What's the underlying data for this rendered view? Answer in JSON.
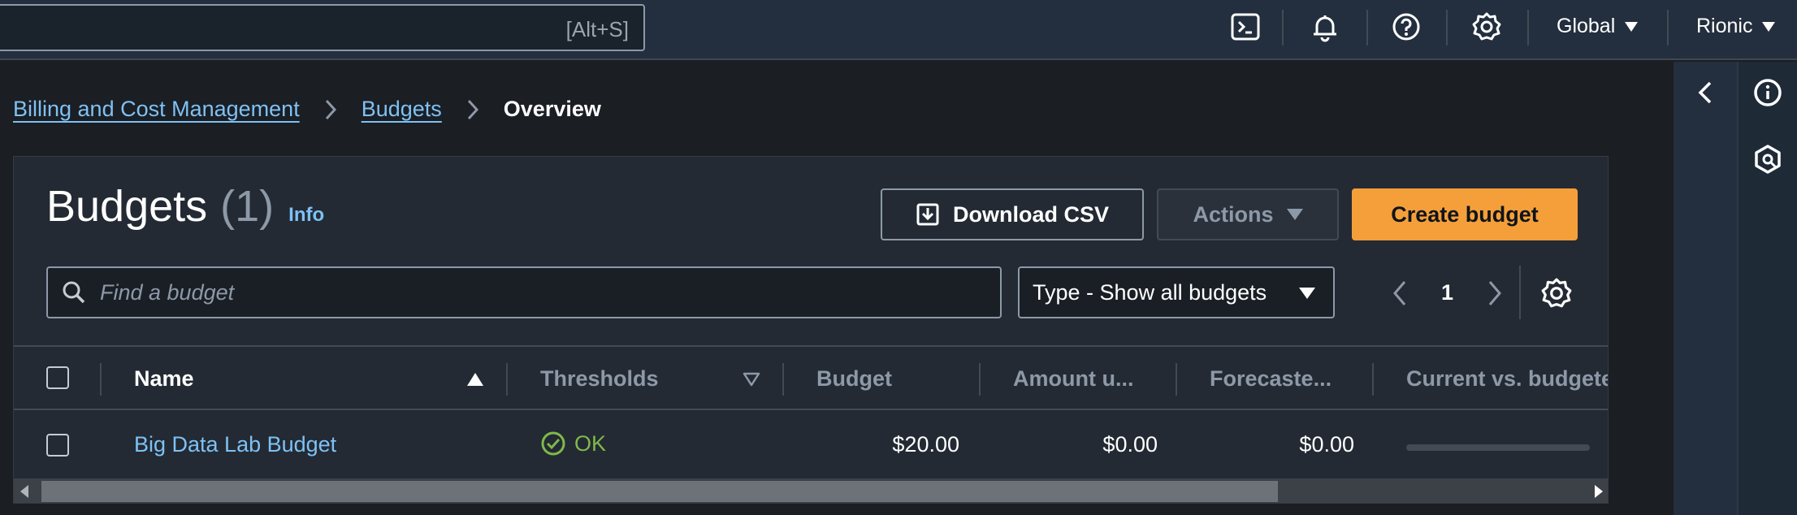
{
  "topbar": {
    "search_shortcut": "[Alt+S]",
    "icons": [
      "cloudshell-icon",
      "notifications-icon",
      "help-icon",
      "settings-icon"
    ],
    "region_label": "Global",
    "account_label": "Rionic"
  },
  "breadcrumb": {
    "items": [
      "Billing and Cost Management",
      "Budgets",
      "Overview"
    ]
  },
  "panel": {
    "title": "Budgets",
    "count": "(1)",
    "info_label": "Info",
    "download_label": "Download CSV",
    "actions_label": "Actions",
    "create_label": "Create budget",
    "search_placeholder": "Find a budget",
    "type_filter": "Type - Show all budgets",
    "page_number": "1"
  },
  "table": {
    "columns": [
      "Name",
      "Thresholds",
      "Budget",
      "Amount u...",
      "Forecaste...",
      "Current vs. budgete"
    ],
    "sort_column": "Name",
    "sort_direction": "ascending",
    "rows": [
      {
        "name": "Big Data Lab Budget",
        "threshold_status": "OK",
        "budget": "$20.00",
        "amount_used": "$0.00",
        "forecasted": "$0.00",
        "current_vs_budget": 0
      }
    ]
  },
  "colors": {
    "accent_link": "#7ec1f5",
    "primary_button": "#f59f3a",
    "status_ok": "#7fb94a",
    "background": "#1b1e23",
    "topbar": "#232f3e"
  }
}
